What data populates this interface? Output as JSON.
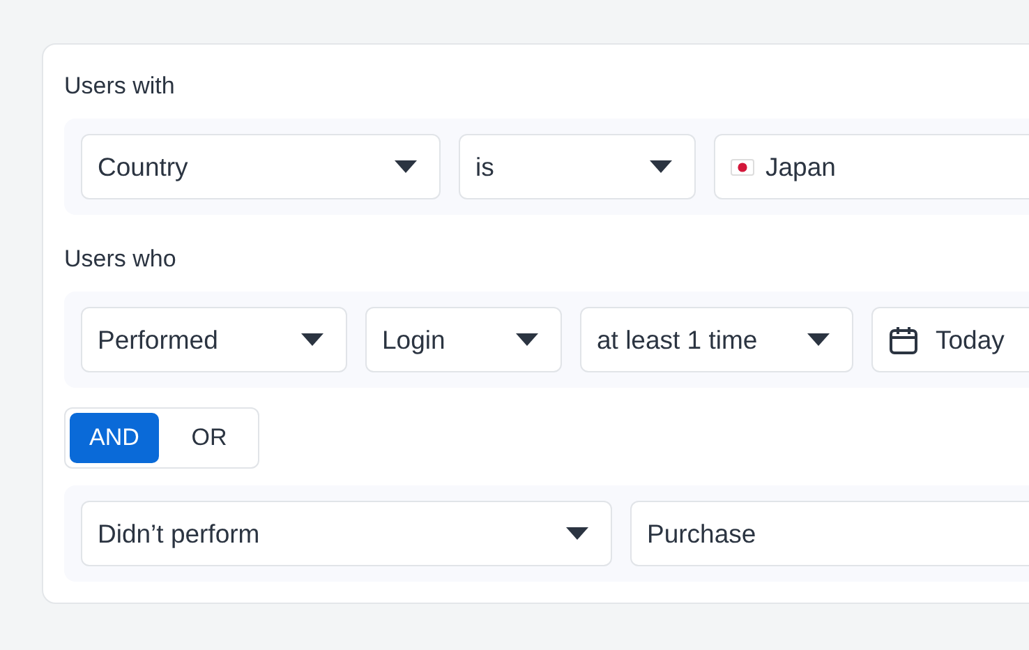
{
  "sections": [
    {
      "heading": "Users with",
      "conditions": [
        {
          "fields": [
            {
              "kind": "select",
              "value": "Country"
            },
            {
              "kind": "select",
              "value": "is"
            },
            {
              "kind": "country",
              "value": "Japan"
            }
          ]
        }
      ]
    },
    {
      "heading": "Users who",
      "conditions": [
        {
          "fields": [
            {
              "kind": "select",
              "value": "Performed"
            },
            {
              "kind": "select",
              "value": "Login"
            },
            {
              "kind": "select",
              "value": "at least 1 time"
            },
            {
              "kind": "date",
              "value": "Today"
            }
          ]
        },
        {
          "fields": [
            {
              "kind": "select",
              "value": "Didn’t perform"
            },
            {
              "kind": "text",
              "value": "Purchase"
            }
          ]
        }
      ],
      "operator": [
        {
          "label": "AND",
          "selected": true
        },
        {
          "label": "OR",
          "selected": false
        }
      ]
    }
  ]
}
